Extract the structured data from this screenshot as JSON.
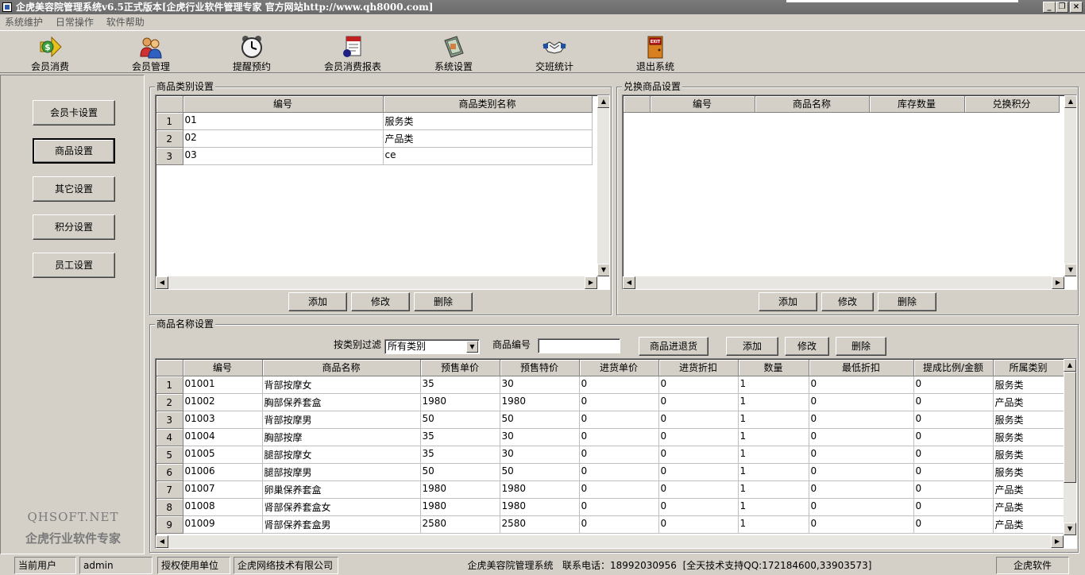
{
  "window": {
    "title": "企虎美容院管理系统v6.5正式版本[企虎行业软件管理专家 官方网站http://www.qh8000.com]",
    "minimize": "_",
    "restore": "❐",
    "close": "×"
  },
  "menu": [
    "系统维护",
    "日常操作",
    "软件帮助"
  ],
  "toolbar": [
    {
      "label": "会员消费",
      "icon": "dollar-arrow-icon"
    },
    {
      "label": "会员管理",
      "icon": "users-icon"
    },
    {
      "label": "提醒预约",
      "icon": "alarm-clock-icon"
    },
    {
      "label": "会员消费报表",
      "icon": "report-icon"
    },
    {
      "label": "系统设置",
      "icon": "settings-book-icon"
    },
    {
      "label": "交班统计",
      "icon": "handshake-icon"
    },
    {
      "label": "退出系统",
      "icon": "exit-door-icon",
      "badge": "EXIT"
    }
  ],
  "sidebar": {
    "buttons": [
      "会员卡设置",
      "商品设置",
      "其它设置",
      "积分设置",
      "员工设置"
    ],
    "active_index": 1,
    "brand_en": "QHSOFT.NET",
    "brand_cn": "企虎行业软件专家"
  },
  "category_panel": {
    "title": "商品类别设置",
    "columns": [
      "编号",
      "商品类别名称"
    ],
    "rows": [
      {
        "n": "1",
        "code": "01",
        "name": "服务类"
      },
      {
        "n": "2",
        "code": "02",
        "name": "产品类"
      },
      {
        "n": "3",
        "code": "03",
        "name": "ce"
      }
    ],
    "buttons": [
      "添加",
      "修改",
      "删除"
    ]
  },
  "exchange_panel": {
    "title": "兑换商品设置",
    "columns": [
      "编号",
      "商品名称",
      "库存数量",
      "兑换积分"
    ],
    "buttons": [
      "添加",
      "修改",
      "删除"
    ]
  },
  "product_panel": {
    "title": "商品名称设置",
    "filter_label": "按类别过滤",
    "filter_value": "所有类别",
    "code_label": "商品编号",
    "code_value": "",
    "buttons": [
      "商品进退货",
      "添加",
      "修改",
      "删除"
    ],
    "columns": [
      "编号",
      "商品名称",
      "预售单价",
      "预售特价",
      "进货单价",
      "进货折扣",
      "数量",
      "最低折扣",
      "提成比例/金额",
      "所属类别"
    ],
    "rows": [
      [
        "1",
        "01001",
        "背部按摩女",
        "35",
        "30",
        "0",
        "0",
        "1",
        "0",
        "0",
        "服务类"
      ],
      [
        "2",
        "01002",
        "胸部保养套盒",
        "1980",
        "1980",
        "0",
        "0",
        "1",
        "0",
        "0",
        "产品类"
      ],
      [
        "3",
        "01003",
        "背部按摩男",
        "50",
        "50",
        "0",
        "0",
        "1",
        "0",
        "0",
        "服务类"
      ],
      [
        "4",
        "01004",
        "胸部按摩",
        "35",
        "30",
        "0",
        "0",
        "1",
        "0",
        "0",
        "服务类"
      ],
      [
        "5",
        "01005",
        "腿部按摩女",
        "35",
        "30",
        "0",
        "0",
        "1",
        "0",
        "0",
        "服务类"
      ],
      [
        "6",
        "01006",
        "腿部按摩男",
        "50",
        "50",
        "0",
        "0",
        "1",
        "0",
        "0",
        "服务类"
      ],
      [
        "7",
        "01007",
        "卵巢保养套盒",
        "1980",
        "1980",
        "0",
        "0",
        "1",
        "0",
        "0",
        "产品类"
      ],
      [
        "8",
        "01008",
        "肾部保养套盒女",
        "1980",
        "1980",
        "0",
        "0",
        "1",
        "0",
        "0",
        "产品类"
      ],
      [
        "9",
        "01009",
        "肾部保养套盒男",
        "2580",
        "2580",
        "0",
        "0",
        "1",
        "0",
        "0",
        "产品类"
      ]
    ]
  },
  "statusbar": {
    "user_label": "当前用户",
    "user_value": "admin",
    "license_label": "授权使用单位",
    "license_value": "企虎网络技术有限公司",
    "info": "企虎美容院管理系统   联系电话：18992030956  [全天技术支持QQ:172184600,33903573]",
    "brand": "企虎软件"
  }
}
